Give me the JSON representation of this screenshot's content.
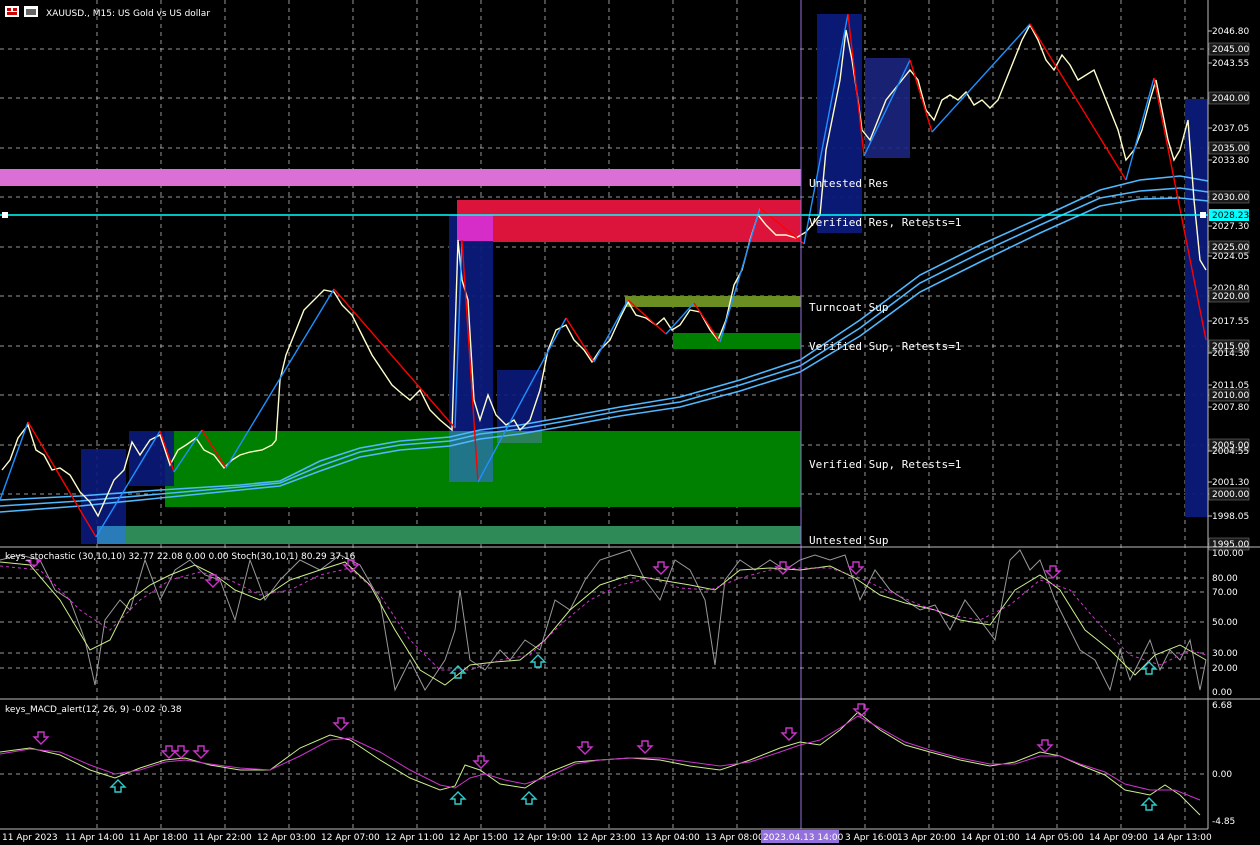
{
  "main": {
    "title": "XAUUSD., M15:  US Gold vs US dollar",
    "price_labels": [
      "2046.80",
      "2045.00",
      "2043.55",
      "2040.00",
      "2037.05",
      "2035.00",
      "2033.80",
      "2030.00",
      "2027.30",
      "2025.00",
      "2024.05",
      "2020.80",
      "2020.00",
      "2017.55",
      "2015.00",
      "2014.30",
      "2011.05",
      "2010.00",
      "2007.80",
      "2005.00",
      "2004.55",
      "2001.30",
      "2000.00",
      "1998.05",
      "1995.00"
    ],
    "current_price": "2028.23",
    "zones": {
      "untested_res": "Untested Res",
      "verified_res": "Verified Res, Retests=1",
      "turncoat_sup": "Turncoat Sup",
      "verified_sup_1": "Verified Sup, Retests=1",
      "verified_sup_2": "Verified Sup, Retests=1",
      "untested_sup": "Untested Sup"
    }
  },
  "stochastic": {
    "title": "keys_stochastic (30,10,10) 32.77 22.08 0.00 0.00 Stoch(30,10,1) 80.29 37.16",
    "levels": [
      "100.00",
      "80.00",
      "70.00",
      "50.00",
      "30.00",
      "20.00",
      "0.00"
    ]
  },
  "macd": {
    "title": "keys_MACD_alert(12, 26, 9) -0.02 -0.38",
    "levels": [
      "6.68",
      "0.00",
      "-4.85"
    ]
  },
  "time_axis": {
    "labels": [
      "11 Apr 2023",
      "11 Apr 14:00",
      "11 Apr 18:00",
      "11 Apr 22:00",
      "12 Apr 03:00",
      "12 Apr 07:00",
      "12 Apr 11:00",
      "12 Apr 15:00",
      "12 Apr 19:00",
      "12 Apr 23:00",
      "13 Apr 04:00",
      "13 Apr 08:00",
      "2023.04.13 14:00",
      "3 Apr 16:00",
      "13 Apr 20:00",
      "14 Apr 01:00",
      "14 Apr 05:00",
      "14 Apr 09:00",
      "14 Apr 13:00"
    ],
    "crosshair_label": "2023.04.13 14:00"
  },
  "colors": {
    "background": "#000000",
    "grid": "#c0c0c0",
    "bullish": "#ffffcc",
    "zigzag_up": "#1e90ff",
    "zigzag_down": "#ff0000",
    "ma": "#4fb8ff",
    "untested_res": "#da70d6",
    "verified_res": "#dc143c",
    "turncoat_sup": "#6b8e23",
    "verified_sup": "#008000",
    "untested_sup": "#2e8b57",
    "current_price_line": "#00ffff",
    "crosshair": "#9370db",
    "sell_arrow": "#cc33cc",
    "buy_arrow": "#33cccc"
  }
}
